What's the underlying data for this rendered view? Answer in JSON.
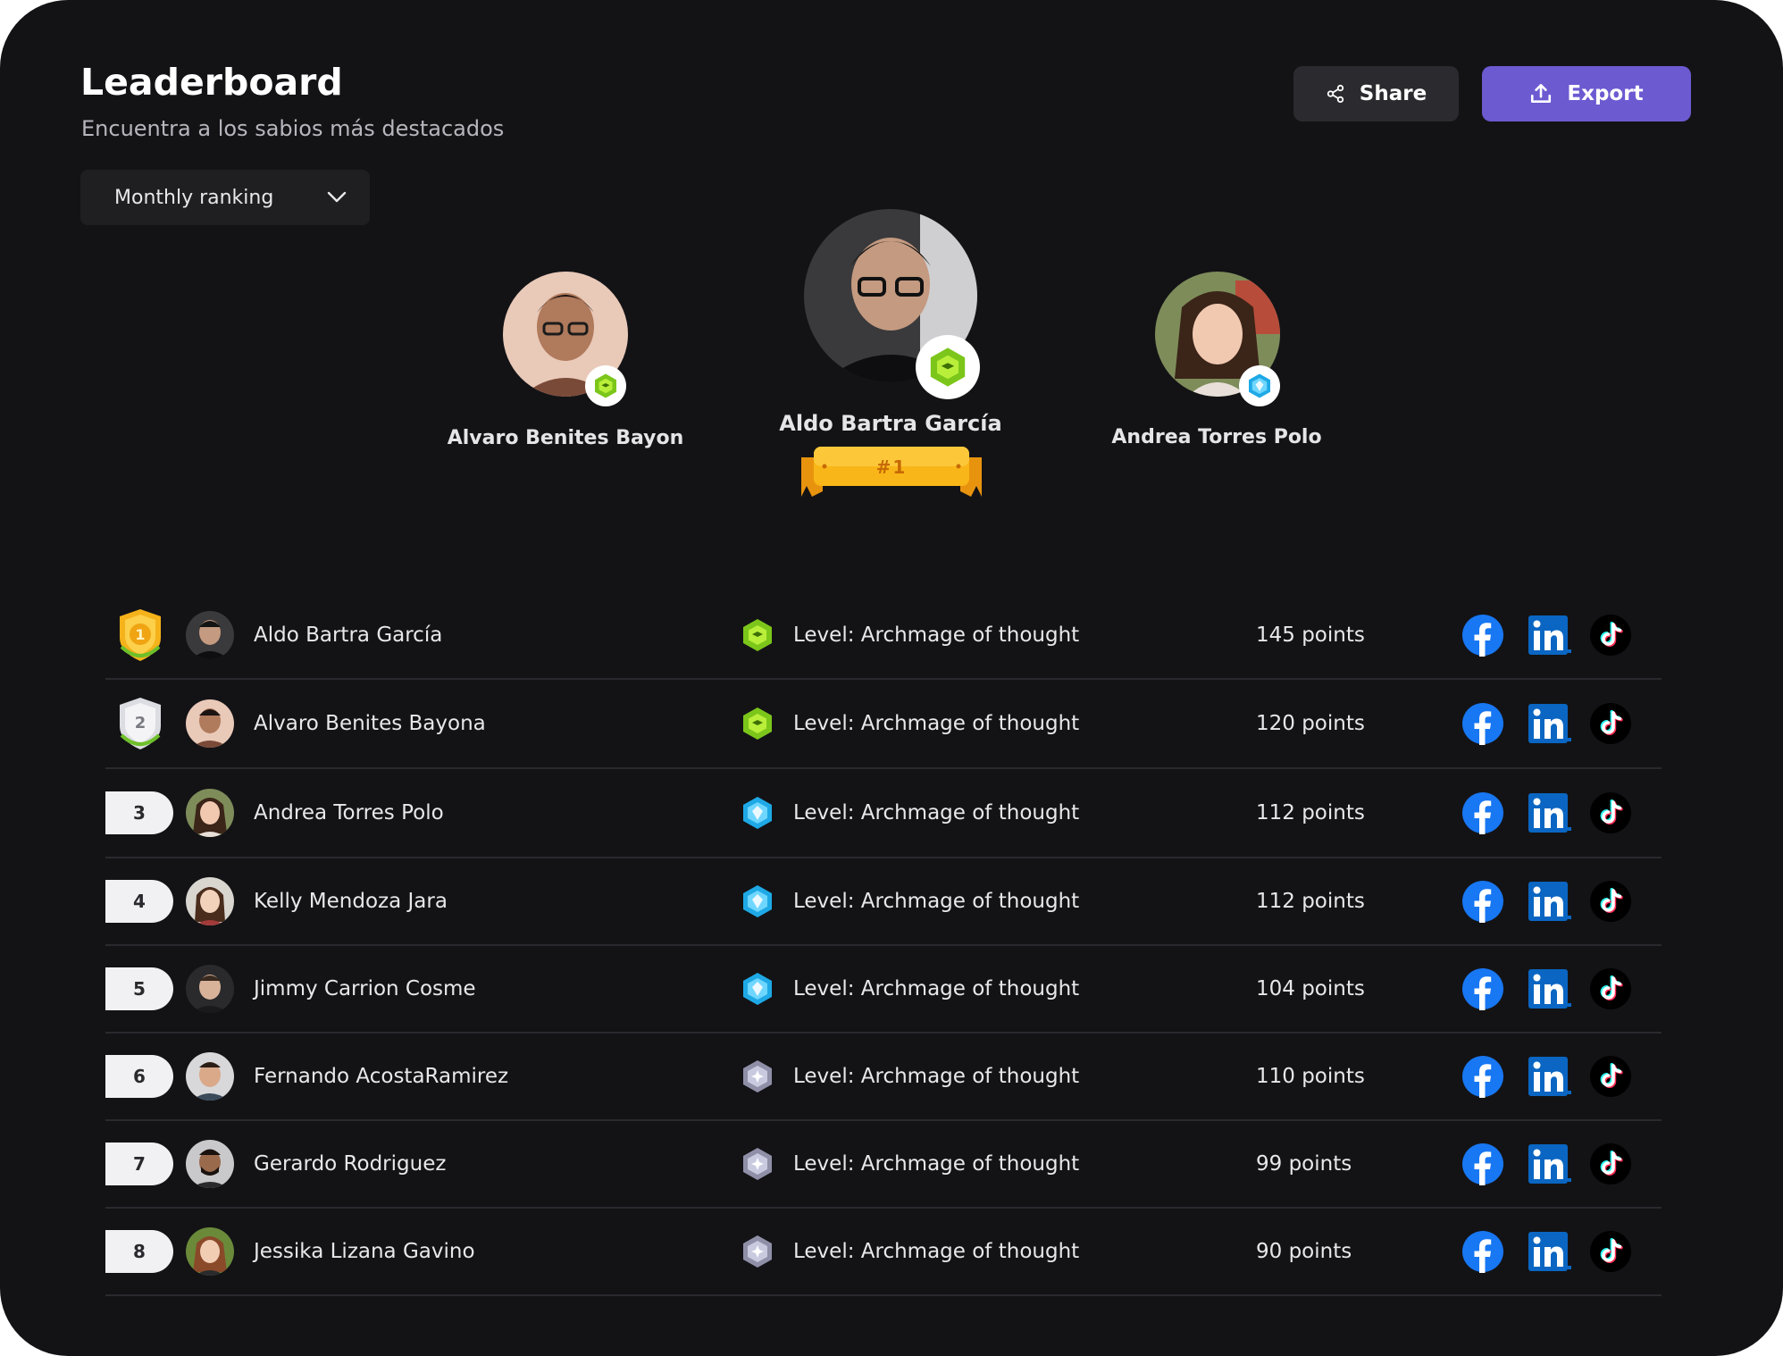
{
  "header": {
    "title": "Leaderboard",
    "subtitle": "Encuentra a los sabios más destacados"
  },
  "actions": {
    "share_label": "Share",
    "export_label": "Export"
  },
  "filter": {
    "selected": "Monthly ranking"
  },
  "podium": {
    "first": {
      "name": "Aldo Bartra García",
      "badge": "#1",
      "level_icon": "green-hexagon-icon"
    },
    "second": {
      "name": "Alvaro Benites Bayon",
      "level_icon": "green-hexagon-icon"
    },
    "third": {
      "name": "Andrea Torres Polo",
      "level_icon": "blue-diamond-icon"
    }
  },
  "rows": [
    {
      "rank": "1",
      "rank_style": "gold-shield",
      "name": "Aldo Bartra García",
      "level": "Level: Archmage of thought",
      "level_icon": "green-hexagon-icon",
      "points": "145 points"
    },
    {
      "rank": "2",
      "rank_style": "silver-shield",
      "name": "Alvaro Benites Bayona",
      "level": "Level: Archmage of thought",
      "level_icon": "green-hexagon-icon",
      "points": "120 points"
    },
    {
      "rank": "3",
      "rank_style": "pill",
      "name": "Andrea Torres Polo",
      "level": "Level: Archmage of thought",
      "level_icon": "blue-diamond-icon",
      "points": "112 points"
    },
    {
      "rank": "4",
      "rank_style": "pill",
      "name": "Kelly Mendoza Jara",
      "level": "Level: Archmage of thought",
      "level_icon": "blue-diamond-icon",
      "points": "112 points"
    },
    {
      "rank": "5",
      "rank_style": "pill",
      "name": "Jimmy Carrion Cosme",
      "level": "Level: Archmage of thought",
      "level_icon": "blue-diamond-icon",
      "points": "104 points"
    },
    {
      "rank": "6",
      "rank_style": "pill",
      "name": "Fernando AcostaRamirez",
      "level": "Level: Archmage of thought",
      "level_icon": "silver-gem-icon",
      "points": "110 points"
    },
    {
      "rank": "7",
      "rank_style": "pill",
      "name": "Gerardo Rodriguez",
      "level": "Level: Archmage of thought",
      "level_icon": "silver-gem-icon",
      "points": "99 points"
    },
    {
      "rank": "8",
      "rank_style": "pill",
      "name": "Jessika Lizana Gavino",
      "level": "Level: Archmage of thought",
      "level_icon": "silver-gem-icon",
      "points": "90 points"
    }
  ],
  "social_icons": [
    "facebook-icon",
    "linkedin-icon",
    "tiktok-icon"
  ],
  "colors": {
    "background": "#131316",
    "accent": "#6c5ad1",
    "gold": "#f5b21a",
    "facebook": "#1877f2",
    "linkedin": "#0a66c2"
  }
}
